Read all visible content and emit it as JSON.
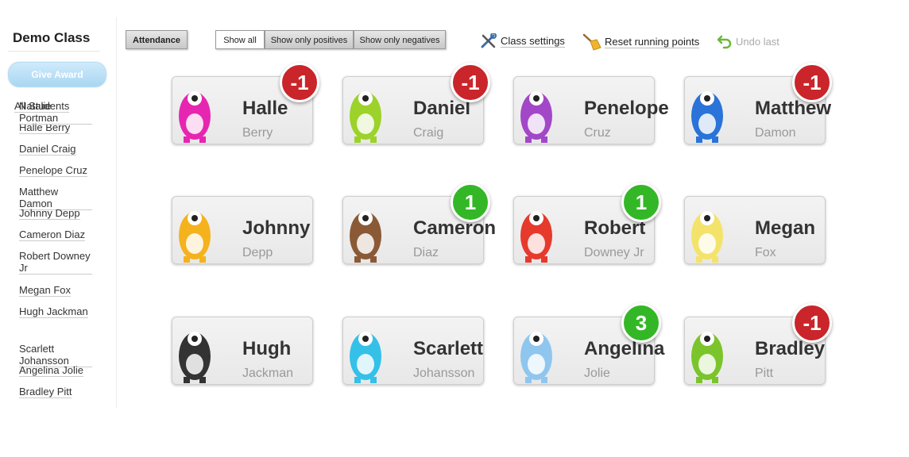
{
  "sidebar": {
    "class_title": "Demo Class",
    "give_award_label": "Give Award",
    "all_students_label": "All Students",
    "students": [
      "Halle Berry",
      "Daniel Craig",
      "Penelope Cruz",
      "Matthew Damon",
      "Johnny Depp",
      "Cameron Diaz",
      "Robert Downey Jr",
      "Megan Fox",
      "Hugh Jackman",
      "Scarlett Johansson",
      "Angelina Jolie",
      "Bradley Pitt",
      "Natalie Portman"
    ]
  },
  "toolbar": {
    "attendance_label": "Attendance",
    "show_all_label": "Show all",
    "show_positives_label": "Show only positives",
    "show_negatives_label": "Show only negatives",
    "class_settings_label": "Class settings",
    "reset_points_label": "Reset running points",
    "undo_label": "Undo last"
  },
  "cards": [
    {
      "first": "Halle",
      "last": "Berry",
      "points": "-1",
      "avatar": "pink-monster-icon",
      "color": "#e626b0"
    },
    {
      "first": "Daniel",
      "last": "Craig",
      "points": "-1",
      "avatar": "green-cyclops-monster-icon",
      "color": "#9cd22a"
    },
    {
      "first": "Penelope",
      "last": "Cruz",
      "points": "",
      "avatar": "purple-furry-monster-icon",
      "color": "#a247c8"
    },
    {
      "first": "Matthew",
      "last": "Damon",
      "points": "-1",
      "avatar": "blue-monster-icon",
      "color": "#2a73d8"
    },
    {
      "first": "Johnny",
      "last": "Depp",
      "points": "",
      "avatar": "yellow-orange-monster-icon",
      "color": "#f4b21d"
    },
    {
      "first": "Cameron",
      "last": "Diaz",
      "points": "1",
      "avatar": "brown-antler-monster-icon",
      "color": "#8a5a36"
    },
    {
      "first": "Robert",
      "last": "Downey Jr",
      "points": "1",
      "avatar": "red-monster-icon",
      "color": "#e63a2d"
    },
    {
      "first": "Megan",
      "last": "Fox",
      "points": "",
      "avatar": "yellow-black-monster-icon",
      "color": "#f3e36b"
    },
    {
      "first": "Hugh",
      "last": "Jackman",
      "points": "",
      "avatar": "black-monster-icon",
      "color": "#333333"
    },
    {
      "first": "Scarlett",
      "last": "Johansson",
      "points": "",
      "avatar": "cyan-fuzzy-monster-icon",
      "color": "#35c0e8"
    },
    {
      "first": "Angelina",
      "last": "Jolie",
      "points": "3",
      "avatar": "light-blue-three-eyed-monster-icon",
      "color": "#8fc6ee"
    },
    {
      "first": "Bradley",
      "last": "Pitt",
      "points": "-1",
      "avatar": "green-slime-monster-icon",
      "color": "#7cc42b"
    }
  ],
  "colors": {
    "negative": "#c9252a",
    "positive": "#34b726"
  }
}
